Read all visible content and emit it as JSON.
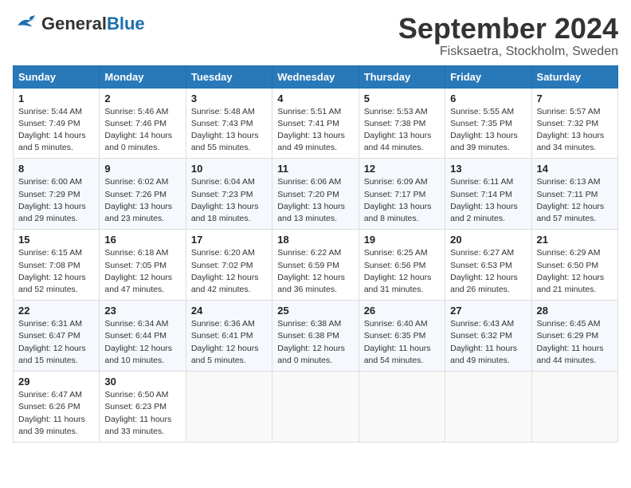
{
  "header": {
    "logo_general": "General",
    "logo_blue": "Blue",
    "month_title": "September 2024",
    "location": "Fisksaetra, Stockholm, Sweden"
  },
  "columns": [
    "Sunday",
    "Monday",
    "Tuesday",
    "Wednesday",
    "Thursday",
    "Friday",
    "Saturday"
  ],
  "weeks": [
    [
      {
        "day": "1",
        "sunrise": "Sunrise: 5:44 AM",
        "sunset": "Sunset: 7:49 PM",
        "daylight": "Daylight: 14 hours and 5 minutes."
      },
      {
        "day": "2",
        "sunrise": "Sunrise: 5:46 AM",
        "sunset": "Sunset: 7:46 PM",
        "daylight": "Daylight: 14 hours and 0 minutes."
      },
      {
        "day": "3",
        "sunrise": "Sunrise: 5:48 AM",
        "sunset": "Sunset: 7:43 PM",
        "daylight": "Daylight: 13 hours and 55 minutes."
      },
      {
        "day": "4",
        "sunrise": "Sunrise: 5:51 AM",
        "sunset": "Sunset: 7:41 PM",
        "daylight": "Daylight: 13 hours and 49 minutes."
      },
      {
        "day": "5",
        "sunrise": "Sunrise: 5:53 AM",
        "sunset": "Sunset: 7:38 PM",
        "daylight": "Daylight: 13 hours and 44 minutes."
      },
      {
        "day": "6",
        "sunrise": "Sunrise: 5:55 AM",
        "sunset": "Sunset: 7:35 PM",
        "daylight": "Daylight: 13 hours and 39 minutes."
      },
      {
        "day": "7",
        "sunrise": "Sunrise: 5:57 AM",
        "sunset": "Sunset: 7:32 PM",
        "daylight": "Daylight: 13 hours and 34 minutes."
      }
    ],
    [
      {
        "day": "8",
        "sunrise": "Sunrise: 6:00 AM",
        "sunset": "Sunset: 7:29 PM",
        "daylight": "Daylight: 13 hours and 29 minutes."
      },
      {
        "day": "9",
        "sunrise": "Sunrise: 6:02 AM",
        "sunset": "Sunset: 7:26 PM",
        "daylight": "Daylight: 13 hours and 23 minutes."
      },
      {
        "day": "10",
        "sunrise": "Sunrise: 6:04 AM",
        "sunset": "Sunset: 7:23 PM",
        "daylight": "Daylight: 13 hours and 18 minutes."
      },
      {
        "day": "11",
        "sunrise": "Sunrise: 6:06 AM",
        "sunset": "Sunset: 7:20 PM",
        "daylight": "Daylight: 13 hours and 13 minutes."
      },
      {
        "day": "12",
        "sunrise": "Sunrise: 6:09 AM",
        "sunset": "Sunset: 7:17 PM",
        "daylight": "Daylight: 13 hours and 8 minutes."
      },
      {
        "day": "13",
        "sunrise": "Sunrise: 6:11 AM",
        "sunset": "Sunset: 7:14 PM",
        "daylight": "Daylight: 13 hours and 2 minutes."
      },
      {
        "day": "14",
        "sunrise": "Sunrise: 6:13 AM",
        "sunset": "Sunset: 7:11 PM",
        "daylight": "Daylight: 12 hours and 57 minutes."
      }
    ],
    [
      {
        "day": "15",
        "sunrise": "Sunrise: 6:15 AM",
        "sunset": "Sunset: 7:08 PM",
        "daylight": "Daylight: 12 hours and 52 minutes."
      },
      {
        "day": "16",
        "sunrise": "Sunrise: 6:18 AM",
        "sunset": "Sunset: 7:05 PM",
        "daylight": "Daylight: 12 hours and 47 minutes."
      },
      {
        "day": "17",
        "sunrise": "Sunrise: 6:20 AM",
        "sunset": "Sunset: 7:02 PM",
        "daylight": "Daylight: 12 hours and 42 minutes."
      },
      {
        "day": "18",
        "sunrise": "Sunrise: 6:22 AM",
        "sunset": "Sunset: 6:59 PM",
        "daylight": "Daylight: 12 hours and 36 minutes."
      },
      {
        "day": "19",
        "sunrise": "Sunrise: 6:25 AM",
        "sunset": "Sunset: 6:56 PM",
        "daylight": "Daylight: 12 hours and 31 minutes."
      },
      {
        "day": "20",
        "sunrise": "Sunrise: 6:27 AM",
        "sunset": "Sunset: 6:53 PM",
        "daylight": "Daylight: 12 hours and 26 minutes."
      },
      {
        "day": "21",
        "sunrise": "Sunrise: 6:29 AM",
        "sunset": "Sunset: 6:50 PM",
        "daylight": "Daylight: 12 hours and 21 minutes."
      }
    ],
    [
      {
        "day": "22",
        "sunrise": "Sunrise: 6:31 AM",
        "sunset": "Sunset: 6:47 PM",
        "daylight": "Daylight: 12 hours and 15 minutes."
      },
      {
        "day": "23",
        "sunrise": "Sunrise: 6:34 AM",
        "sunset": "Sunset: 6:44 PM",
        "daylight": "Daylight: 12 hours and 10 minutes."
      },
      {
        "day": "24",
        "sunrise": "Sunrise: 6:36 AM",
        "sunset": "Sunset: 6:41 PM",
        "daylight": "Daylight: 12 hours and 5 minutes."
      },
      {
        "day": "25",
        "sunrise": "Sunrise: 6:38 AM",
        "sunset": "Sunset: 6:38 PM",
        "daylight": "Daylight: 12 hours and 0 minutes."
      },
      {
        "day": "26",
        "sunrise": "Sunrise: 6:40 AM",
        "sunset": "Sunset: 6:35 PM",
        "daylight": "Daylight: 11 hours and 54 minutes."
      },
      {
        "day": "27",
        "sunrise": "Sunrise: 6:43 AM",
        "sunset": "Sunset: 6:32 PM",
        "daylight": "Daylight: 11 hours and 49 minutes."
      },
      {
        "day": "28",
        "sunrise": "Sunrise: 6:45 AM",
        "sunset": "Sunset: 6:29 PM",
        "daylight": "Daylight: 11 hours and 44 minutes."
      }
    ],
    [
      {
        "day": "29",
        "sunrise": "Sunrise: 6:47 AM",
        "sunset": "Sunset: 6:26 PM",
        "daylight": "Daylight: 11 hours and 39 minutes."
      },
      {
        "day": "30",
        "sunrise": "Sunrise: 6:50 AM",
        "sunset": "Sunset: 6:23 PM",
        "daylight": "Daylight: 11 hours and 33 minutes."
      },
      null,
      null,
      null,
      null,
      null
    ]
  ]
}
